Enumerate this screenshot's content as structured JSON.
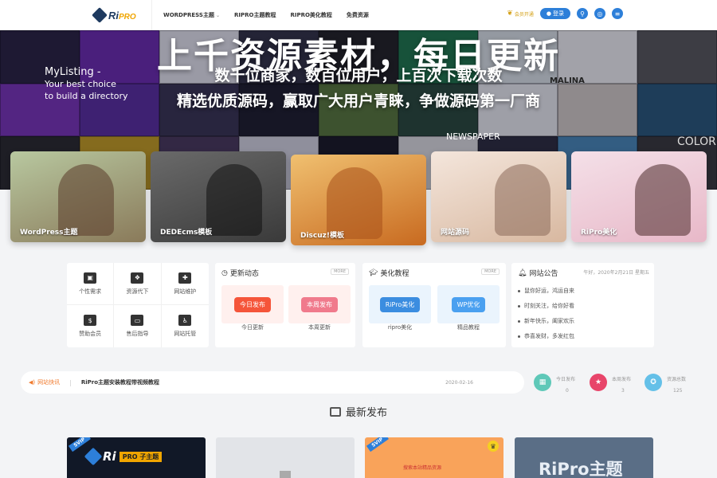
{
  "header": {
    "logo_text": "Ri",
    "logo_pro": "PRO",
    "nav": [
      "WORDPRESS主题",
      "RIPRO主题教程",
      "RIPRO美化教程",
      "免费资源"
    ],
    "vip_label": "会员开通",
    "login_label": "登录",
    "icons": [
      "search-icon",
      "settings-icon",
      "menu-icon"
    ]
  },
  "banner": {
    "title": "上千资源素材，每日更新",
    "sub1": "数十位商家，数百位用户，上百次下载次数",
    "sub2": "精选优质源码，赢取广大用户青睐，争做源码第一厂商",
    "bg_labels": {
      "mylisting_1": "MyListing -",
      "mylisting_2": "Your best choice",
      "mylisting_3": "to build a directory",
      "malina": "MALINA",
      "newspaper": "NEWSPAPER",
      "color": "COLOR"
    }
  },
  "categories": [
    {
      "label": "WordPress主题",
      "color1": "#b8c8a0",
      "color2": "#8a7a5a"
    },
    {
      "label": "DEDEcms模板",
      "color1": "#6a6a6a",
      "color2": "#3a3a3a"
    },
    {
      "label": "Discuz!模板",
      "color1": "#f0c070",
      "color2": "#c86a20"
    },
    {
      "label": "网站源码",
      "color1": "#f4e6dc",
      "color2": "#d8b8a0"
    },
    {
      "label": "RiPro美化",
      "color1": "#f4e0e8",
      "color2": "#e8b8c8"
    }
  ],
  "services": [
    {
      "label": "个性需求",
      "icon": "briefcase-icon"
    },
    {
      "label": "资源代下",
      "icon": "boxes-icon"
    },
    {
      "label": "网站维护",
      "icon": "truck-icon"
    },
    {
      "label": "赞助会员",
      "icon": "money-icon"
    },
    {
      "label": "售后指导",
      "icon": "laptop-icon"
    },
    {
      "label": "网站托管",
      "icon": "person-icon"
    }
  ],
  "updates": {
    "title": "更新动态",
    "more": "MORE",
    "tags": [
      {
        "pill": "今日发布",
        "caption": "今日更新",
        "bg": "#fff0ee",
        "pill_color": "#f5553a"
      },
      {
        "pill": "本周发布",
        "caption": "本周更新",
        "bg": "#fff0ee",
        "pill_color": "#f07a8c"
      }
    ]
  },
  "tutorials": {
    "title": "美化教程",
    "more": "MORE",
    "tags": [
      {
        "pill": "RiPro美化",
        "caption": "ripro美化",
        "bg": "#eaf4fd",
        "pill_color": "#3b8de0"
      },
      {
        "pill": "WP优化",
        "caption": "精品教程",
        "bg": "#eaf4fd",
        "pill_color": "#4aa0f0"
      }
    ]
  },
  "notice": {
    "title": "网站公告",
    "date": "午好，2020年2月21日 星期五",
    "items": [
      "鼠你好运，鸿运自来",
      "时刻关注，给你好看",
      "新年快乐，阖家欢乐",
      "恭喜发财，多发红包"
    ]
  },
  "ticker": {
    "label": "网站快讯",
    "text": "RiPro主题安装教程带视频教程",
    "date": "2020-02-16"
  },
  "stats": [
    {
      "label": "今日发布",
      "value": "0",
      "color": "#5ec8b8",
      "icon": "calendar-icon"
    },
    {
      "label": "本周发布",
      "value": "3",
      "color": "#e8456a",
      "icon": "star-icon"
    },
    {
      "label": "资源总数",
      "value": "125",
      "color": "#64c0e8",
      "icon": "badge-icon"
    }
  ],
  "section": {
    "title": "最新发布"
  },
  "posts": [
    {
      "badge": "SVIP",
      "title": "Ri",
      "tag": "PRO 子主题",
      "bg": "#111827"
    },
    {
      "badge": "",
      "title": "",
      "tag": "",
      "bg": "#e2e4e8"
    },
    {
      "badge": "SVIP",
      "title": "",
      "tag": "搜索本站精品资源",
      "bg": "#f9a35a"
    },
    {
      "badge": "",
      "title": "RiPro主题",
      "tag": "",
      "bg": "#5a6e86"
    }
  ]
}
